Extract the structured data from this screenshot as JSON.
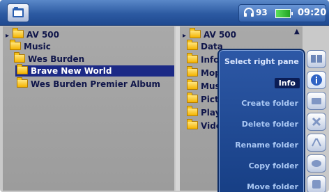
{
  "status_bar": {
    "volume": "93",
    "time": "09:20",
    "icons": [
      "app-folder-icon",
      "headphones-icon",
      "battery-icon"
    ]
  },
  "left_pane": {
    "rows": [
      {
        "label": "AV 500"
      },
      {
        "label": "Music"
      },
      {
        "label": "Wes Burden"
      },
      {
        "label": "Brave New World",
        "selected": true
      },
      {
        "label": "Wes Burden Premier Album"
      }
    ]
  },
  "right_pane": {
    "root": "AV 500",
    "rows": [
      {
        "label": "Data"
      },
      {
        "label": "Info"
      },
      {
        "label": "Mopl"
      },
      {
        "label": "Musi"
      },
      {
        "label": "Pictu"
      },
      {
        "label": "Playl"
      },
      {
        "label": "Video"
      }
    ]
  },
  "context_menu": {
    "title": "Select right pane",
    "items": [
      {
        "label": "Info",
        "active": true
      },
      {
        "label": "Create folder"
      },
      {
        "label": "Delete folder"
      },
      {
        "label": "Rename folder"
      },
      {
        "label": "Copy folder"
      },
      {
        "label": "Move folder"
      }
    ]
  },
  "side_buttons": [
    "pane-switch-icon",
    "info-icon",
    "create-folder-icon",
    "delete-icon",
    "rename-icon",
    "copy-icon",
    "move-icon"
  ],
  "colors": {
    "topbar": "#2c5aa2",
    "menu": "#1f4a96",
    "selection": "#1c2a86",
    "folder": "#f5b400"
  }
}
